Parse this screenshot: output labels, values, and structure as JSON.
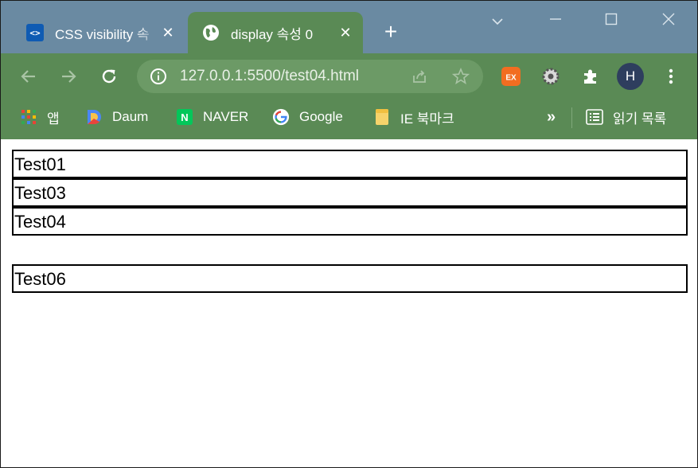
{
  "tabs": [
    {
      "title": "CSS visibility 속",
      "active": false
    },
    {
      "title": "display 속성 0",
      "active": true
    }
  ],
  "toolbar": {
    "url": "127.0.0.1:5500/test04.html",
    "profile_initial": "H"
  },
  "bookmarks": {
    "items": [
      {
        "label": "앱",
        "icon": "apps-grid-icon"
      },
      {
        "label": "Daum",
        "icon": "daum-icon"
      },
      {
        "label": "NAVER",
        "icon": "naver-icon"
      },
      {
        "label": "Google",
        "icon": "google-icon"
      },
      {
        "label": "IE 북마크",
        "icon": "folder-icon"
      }
    ],
    "more_label": "»",
    "reading_list_label": "읽기 목록"
  },
  "page": {
    "boxes": [
      "Test01",
      "Test03",
      "Test04",
      "Test06"
    ]
  },
  "colors": {
    "tabstrip": "#6a8aa2",
    "toolbar": "#5a8a55",
    "omnibox": "#6c9a66"
  }
}
